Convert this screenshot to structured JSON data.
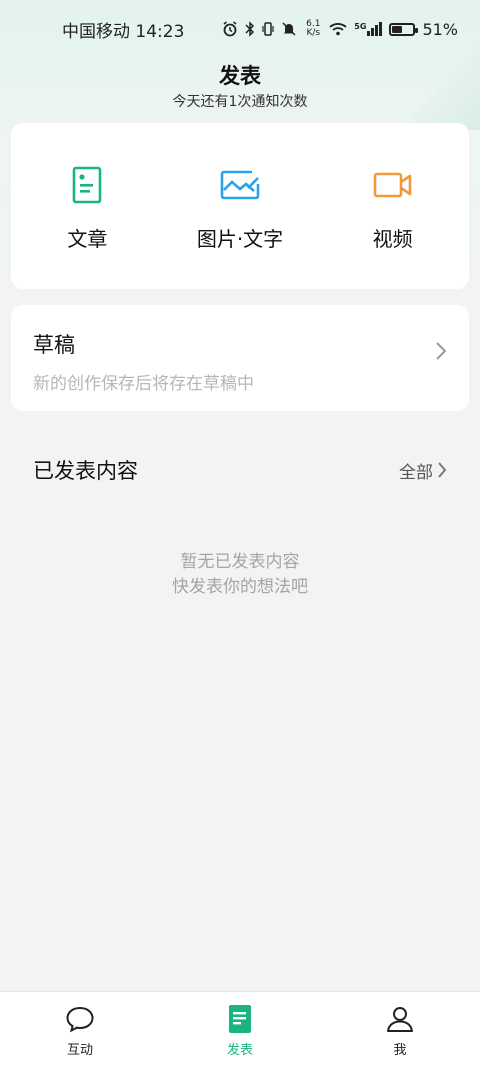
{
  "status_bar": {
    "carrier_time": "中国移动 14:23",
    "net_speed_value": "6.1",
    "net_speed_unit": "K/s",
    "network_type": "5G",
    "battery_percent": "51%",
    "battery_level": 0.51,
    "icons": [
      "alarm-icon",
      "bluetooth-icon",
      "vibrate-icon",
      "mute-icon",
      "wifi-icon",
      "signal-icon",
      "battery-icon"
    ]
  },
  "header": {
    "title": "发表",
    "subtitle": "今天还有1次通知次数"
  },
  "publish_options": [
    {
      "label": "文章",
      "icon": "article-icon",
      "color": "#1bb380"
    },
    {
      "label": "图片·文字",
      "icon": "image-text-icon",
      "color": "#2aa3e6"
    },
    {
      "label": "视频",
      "icon": "video-icon",
      "color": "#f09a3e"
    }
  ],
  "draft": {
    "title": "草稿",
    "description": "新的创作保存后将存在草稿中"
  },
  "published": {
    "title": "已发表内容",
    "see_all": "全部",
    "empty_line1": "暂无已发表内容",
    "empty_line2": "快发表你的想法吧"
  },
  "bottom_nav": [
    {
      "label": "互动",
      "icon": "chat-bubble-icon",
      "active": false
    },
    {
      "label": "发表",
      "icon": "publish-doc-icon",
      "active": true
    },
    {
      "label": "我",
      "icon": "person-icon",
      "active": false
    }
  ],
  "colors": {
    "accent": "#1bb380",
    "image_blue": "#2aa3e6",
    "video_orange": "#f09a3e",
    "muted_text": "#b6b6b6"
  }
}
